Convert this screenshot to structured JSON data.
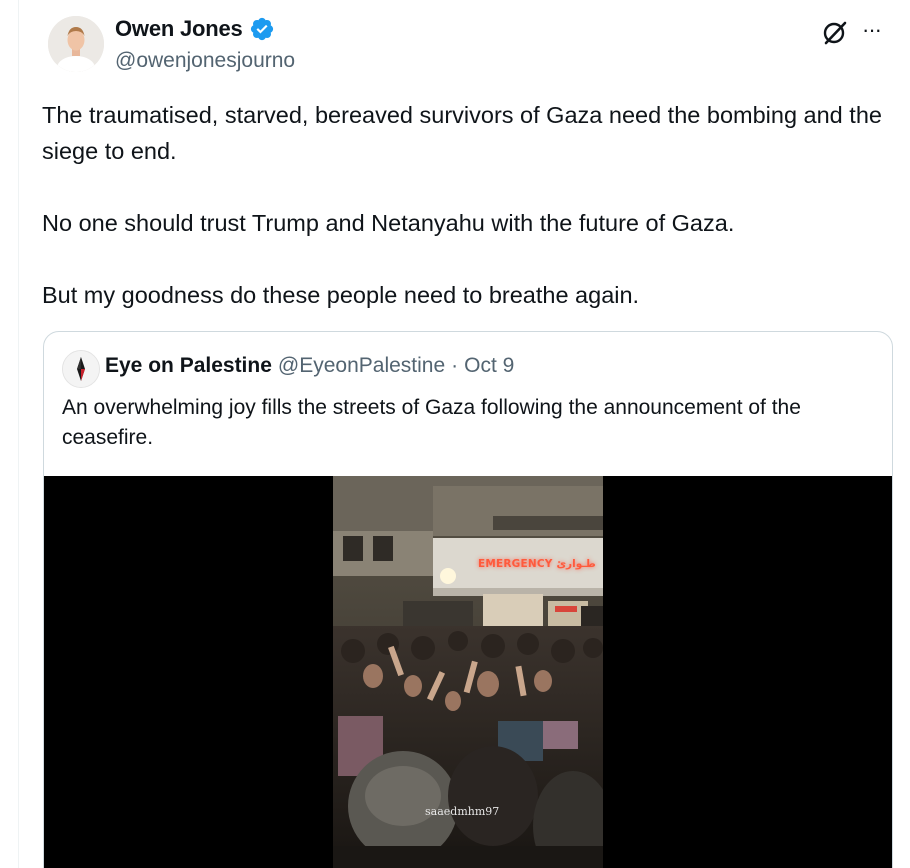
{
  "author": {
    "display_name": "Owen Jones",
    "handle": "@owenjonesjourno",
    "verified": true,
    "avatar_icon": "profile-photo"
  },
  "actions": {
    "grok_icon": "grok-icon",
    "more_icon": "more-options-icon",
    "more_glyph": "···"
  },
  "tweet": {
    "paragraphs": [
      "The traumatised, starved, bereaved survivors of Gaza need the bombing and the siege to end.",
      "No one should trust Trump and Netanyahu with the future of Gaza.",
      "But my goodness do these people need to breathe again."
    ]
  },
  "quoted_tweet": {
    "display_name": "Eye on Palestine",
    "handle": "@EyeonPalestine",
    "separator": "·",
    "date": "Oct 9",
    "text": "An overwhelming joy fills the streets of Gaza following the announcement of the ceasefire.",
    "media": {
      "type": "video",
      "sign_text": "EMERGENCY طـوارئ",
      "watermark": "saaedmhm97"
    }
  },
  "colors": {
    "text_primary": "#0f1419",
    "text_secondary": "#536471",
    "verified_blue": "#1d9bf0",
    "border": "#cfd9de"
  }
}
